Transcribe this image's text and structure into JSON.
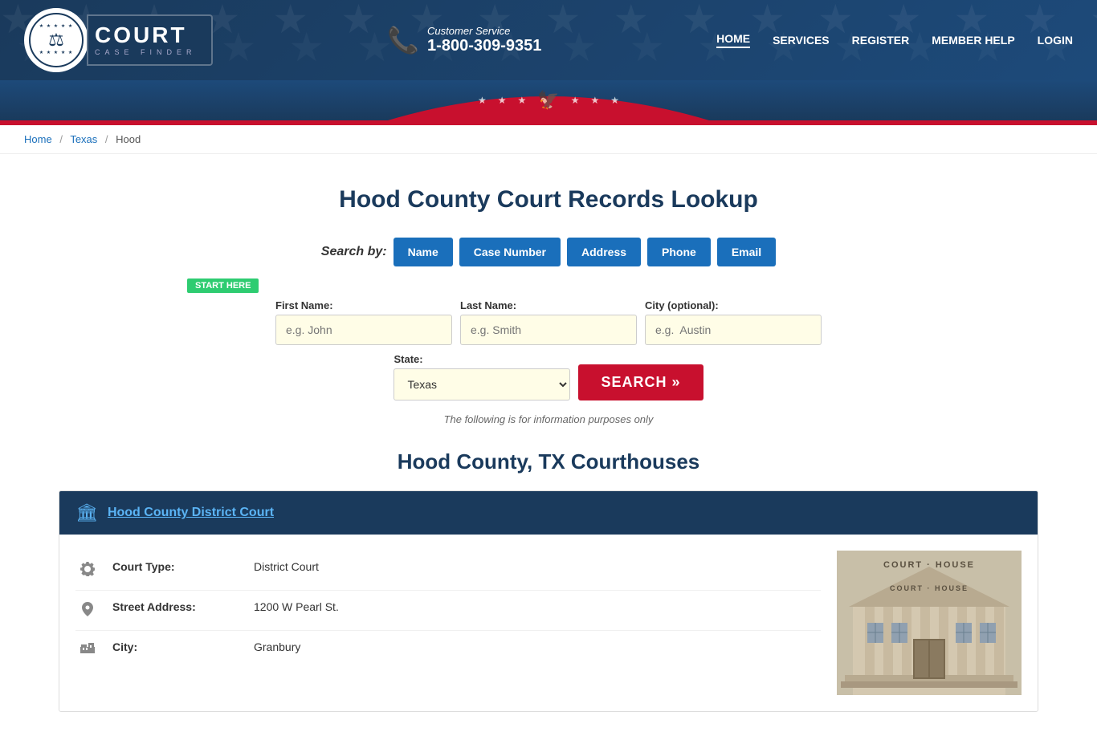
{
  "header": {
    "logo": {
      "court_text": "COURT",
      "case_finder_text": "CASE FINDER",
      "icon": "⚖"
    },
    "contact": {
      "label": "Customer Service",
      "phone": "1-800-309-9351"
    },
    "nav": {
      "items": [
        {
          "id": "home",
          "label": "HOME"
        },
        {
          "id": "services",
          "label": "SERVICES"
        },
        {
          "id": "register",
          "label": "REGISTER"
        },
        {
          "id": "member-help",
          "label": "MEMBER HELP"
        },
        {
          "id": "login",
          "label": "LOGIN"
        }
      ]
    }
  },
  "breadcrumb": {
    "items": [
      {
        "label": "Home",
        "href": "#"
      },
      {
        "label": "Texas",
        "href": "#"
      },
      {
        "label": "Hood",
        "href": "#",
        "current": true
      }
    ]
  },
  "main": {
    "page_title": "Hood County Court Records Lookup",
    "search": {
      "search_by_label": "Search by:",
      "tabs": [
        {
          "id": "name",
          "label": "Name",
          "active": true
        },
        {
          "id": "case-number",
          "label": "Case Number"
        },
        {
          "id": "address",
          "label": "Address"
        },
        {
          "id": "phone",
          "label": "Phone"
        },
        {
          "id": "email",
          "label": "Email"
        }
      ],
      "start_here_badge": "START HERE",
      "fields": {
        "first_name_label": "First Name:",
        "first_name_placeholder": "e.g. John",
        "last_name_label": "Last Name:",
        "last_name_placeholder": "e.g. Smith",
        "city_label": "City (optional):",
        "city_placeholder": "e.g.  Austin",
        "state_label": "State:",
        "state_value": "Texas"
      },
      "search_button_label": "SEARCH »",
      "info_note": "The following is for information purposes only"
    },
    "courthouses_title": "Hood County, TX Courthouses",
    "courts": [
      {
        "id": "hood-district",
        "icon": "🏛",
        "title": "Hood County District Court",
        "details": [
          {
            "icon": "⚙",
            "label": "Court Type:",
            "value": "District Court"
          },
          {
            "icon": "📍",
            "label": "Street Address:",
            "value": "1200 W Pearl St."
          },
          {
            "icon": "🏢",
            "label": "City:",
            "value": "Granbury"
          }
        ]
      }
    ]
  }
}
